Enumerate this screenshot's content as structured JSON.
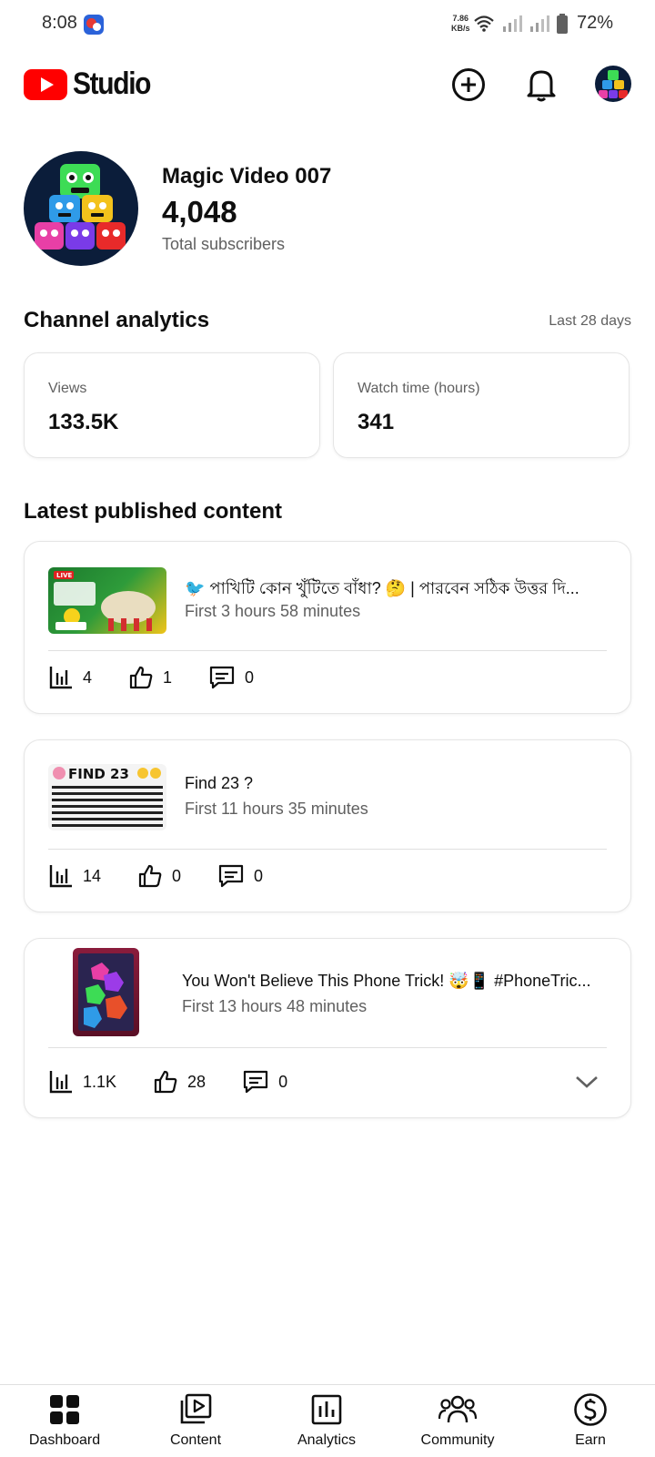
{
  "status_bar": {
    "time": "8:08",
    "net_speed_value": "7.86",
    "net_speed_unit": "KB/s",
    "battery": "72%"
  },
  "app_bar": {
    "logo_text": "Studio",
    "brand_color": "#ff0000"
  },
  "channel": {
    "name": "Magic Video 007",
    "subscribers": "4,048",
    "subscribers_label": "Total subscribers"
  },
  "analytics": {
    "title": "Channel analytics",
    "range": "Last 28 days",
    "views_label": "Views",
    "views_value": "133.5K",
    "watch_label": "Watch time (hours)",
    "watch_value": "341"
  },
  "latest": {
    "title": "Latest published content",
    "videos": [
      {
        "title": "🐦 পাখিটি কোন খুঁটিতে বাঁধা? 🤔 | পারবেন সঠিক উত্তর দি...",
        "subtitle": "First 3 hours 58 minutes",
        "views": "4",
        "likes": "1",
        "comments": "0",
        "thumb_text": "LIVE"
      },
      {
        "title": "Find 23 ?",
        "subtitle": "First 11 hours 35 minutes",
        "views": "14",
        "likes": "0",
        "comments": "0",
        "thumb_text": "FIND 23"
      },
      {
        "title": "You Won't Believe This Phone Trick! 🤯📱 #PhoneTric...",
        "subtitle": "First 13 hours 48 minutes",
        "views": "1.1K",
        "likes": "28",
        "comments": "0"
      }
    ]
  },
  "bottom_nav": {
    "items": [
      {
        "label": "Dashboard",
        "icon": "dashboard-icon"
      },
      {
        "label": "Content",
        "icon": "content-icon"
      },
      {
        "label": "Analytics",
        "icon": "analytics-icon"
      },
      {
        "label": "Community",
        "icon": "community-icon"
      },
      {
        "label": "Earn",
        "icon": "earn-icon"
      }
    ]
  }
}
